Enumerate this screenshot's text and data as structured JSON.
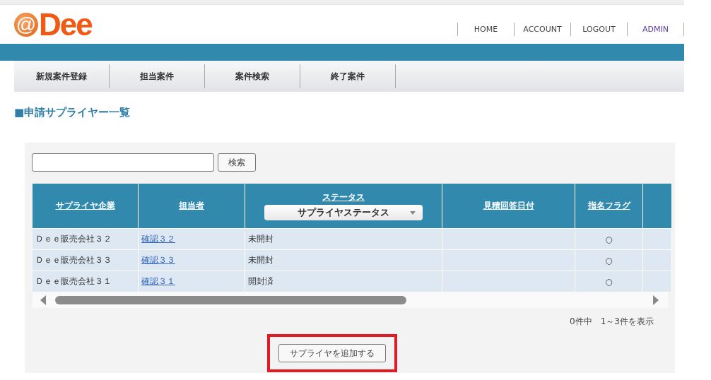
{
  "logo": {
    "mark": "@",
    "name": "Dee"
  },
  "top_links": [
    {
      "label": "HOME",
      "selected": false
    },
    {
      "label": "ACCOUNT",
      "selected": false
    },
    {
      "label": "LOGOUT",
      "selected": false
    },
    {
      "label": "ADMIN",
      "selected": true
    }
  ],
  "menu": [
    "新規案件登録",
    "担当案件",
    "案件検索",
    "終了案件"
  ],
  "page_title": "■申請サプライヤー一覧",
  "search": {
    "button": "検索"
  },
  "table": {
    "columns": [
      {
        "kind": "sort",
        "label": "サプライヤ企業"
      },
      {
        "kind": "sort",
        "label": "担当者"
      },
      {
        "kind": "filter",
        "label": "ステータス",
        "select": "サプライヤステータス"
      },
      {
        "kind": "sort",
        "label": "見積回答日付"
      },
      {
        "kind": "sort",
        "label": "指名フラグ"
      },
      {
        "kind": "cut"
      }
    ],
    "rows": [
      {
        "company": "Ｄｅｅ販売会社３２",
        "contact": "確認３２",
        "status": "未開封",
        "flag": "○"
      },
      {
        "company": "Ｄｅｅ販売会社３３",
        "contact": "確認３３",
        "status": "未開封",
        "flag": "○"
      },
      {
        "company": "Ｄｅｅ販売会社３１",
        "contact": "確認３１",
        "status": "開封済",
        "flag": "○"
      }
    ]
  },
  "count": "0件中　1～3件を表示",
  "add_button": {
    "label": "サプライヤを追加する",
    "highlighted": true
  }
}
